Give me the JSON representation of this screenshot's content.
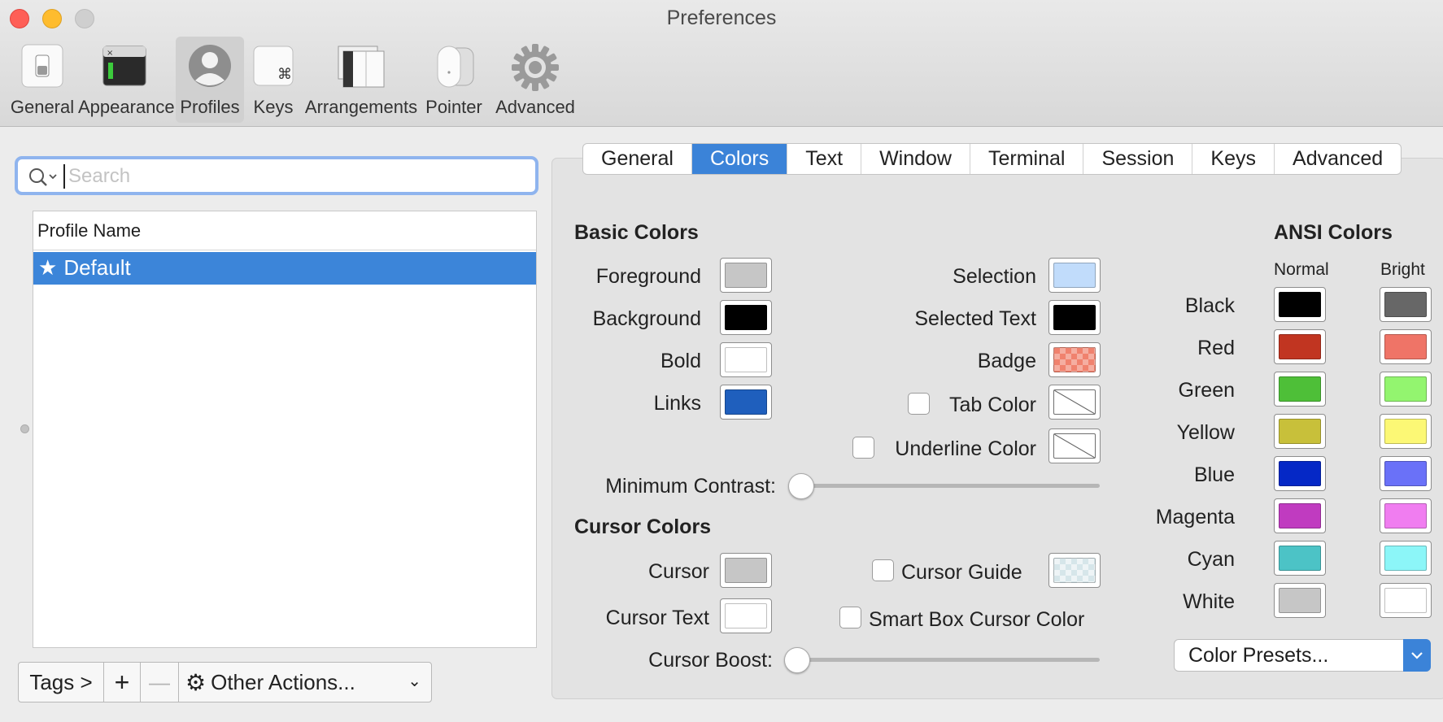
{
  "window": {
    "title": "Preferences"
  },
  "toolbar": {
    "items": [
      {
        "label": "General",
        "icon": "switch-icon"
      },
      {
        "label": "Appearance",
        "icon": "terminal-window-icon"
      },
      {
        "label": "Profiles",
        "icon": "user-silhouette-icon",
        "selected": true
      },
      {
        "label": "Keys",
        "icon": "command-key-icon"
      },
      {
        "label": "Arrangements",
        "icon": "windows-stack-icon"
      },
      {
        "label": "Pointer",
        "icon": "mouse-icon"
      },
      {
        "label": "Advanced",
        "icon": "gear-icon"
      }
    ]
  },
  "sidebar": {
    "search": {
      "placeholder": "Search",
      "value": ""
    },
    "list_header": "Profile Name",
    "profiles": [
      {
        "name": "Default",
        "starred": true,
        "selected": true
      }
    ],
    "buttons": {
      "tags": "Tags >",
      "add": "+",
      "remove": "—",
      "other_actions": "Other Actions..."
    }
  },
  "tabs": {
    "items": [
      "General",
      "Colors",
      "Text",
      "Window",
      "Terminal",
      "Session",
      "Keys",
      "Advanced"
    ],
    "active": "Colors"
  },
  "basic_colors": {
    "title": "Basic Colors",
    "left": [
      {
        "label": "Foreground",
        "color": "#c6c6c6"
      },
      {
        "label": "Background",
        "color": "#000000"
      },
      {
        "label": "Bold",
        "color": "#ffffff"
      },
      {
        "label": "Links",
        "color": "#1f5fbd"
      }
    ],
    "right": [
      {
        "label": "Selection",
        "color": "#c1dcfb"
      },
      {
        "label": "Selected Text",
        "color": "#000000"
      },
      {
        "label": "Badge",
        "color": "#f0826e"
      },
      {
        "label": "Tab Color",
        "checked": false
      },
      {
        "label": "Underline Color",
        "checked": false
      }
    ],
    "min_contrast_label": "Minimum Contrast:",
    "min_contrast_value": 0
  },
  "cursor_colors": {
    "title": "Cursor Colors",
    "cursor": {
      "label": "Cursor",
      "color": "#c6c6c6"
    },
    "cursor_text": {
      "label": "Cursor Text",
      "color": "#ffffff"
    },
    "cursor_guide": {
      "label": "Cursor Guide",
      "checked": false
    },
    "smart_box": {
      "label": "Smart Box Cursor Color",
      "checked": false
    },
    "boost_label": "Cursor Boost:",
    "boost_value": 0
  },
  "ansi": {
    "title": "ANSI Colors",
    "normal_label": "Normal",
    "bright_label": "Bright",
    "rows": [
      {
        "name": "Black",
        "normal": "#000000",
        "bright": "#676767"
      },
      {
        "name": "Red",
        "normal": "#c13521",
        "bright": "#ef7467"
      },
      {
        "name": "Green",
        "normal": "#4ebf38",
        "bright": "#93f56f"
      },
      {
        "name": "Yellow",
        "normal": "#c8c03a",
        "bright": "#fcf875"
      },
      {
        "name": "Blue",
        "normal": "#0528c6",
        "bright": "#6a71f8"
      },
      {
        "name": "Magenta",
        "normal": "#c03bc0",
        "bright": "#f07df0"
      },
      {
        "name": "Cyan",
        "normal": "#4cc3c6",
        "bright": "#8cf6f8"
      },
      {
        "name": "White",
        "normal": "#c6c6c6",
        "bright": "#ffffff"
      }
    ],
    "presets_label": "Color Presets..."
  },
  "colors": {
    "accent": "#3b83d8",
    "selection_row": "#3c85d9"
  }
}
